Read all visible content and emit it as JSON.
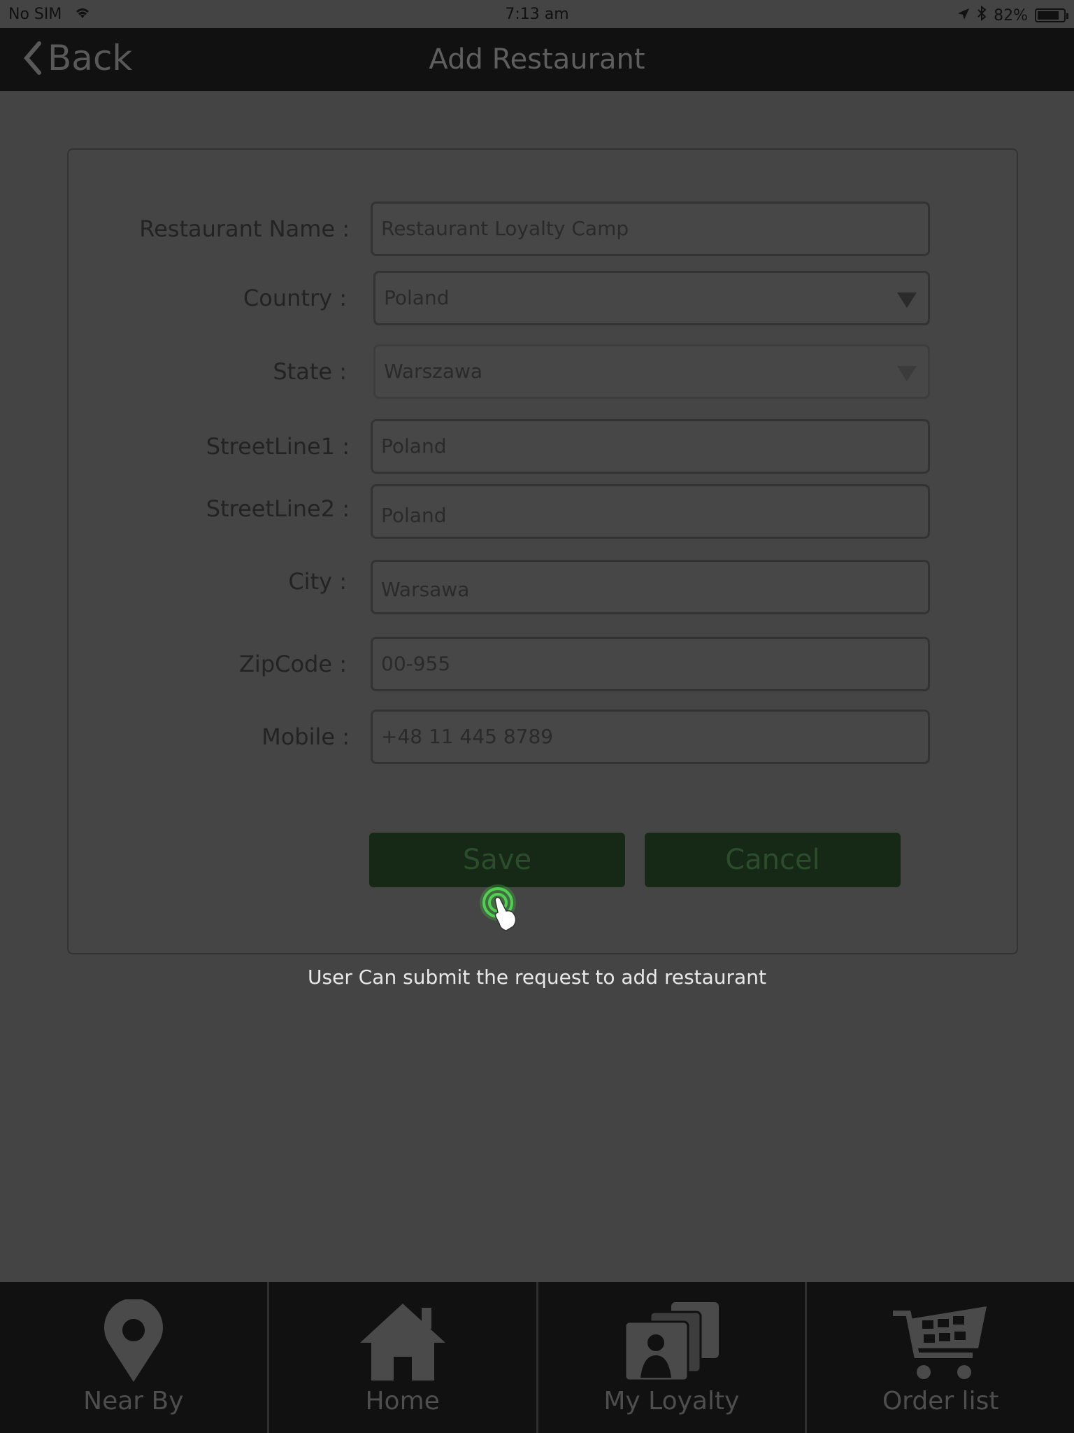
{
  "status_bar": {
    "carrier": "No SIM",
    "time": "7:13 am",
    "battery_level": 0.82,
    "battery_text": "82%"
  },
  "nav": {
    "back_label": "Back",
    "title": "Add Restaurant"
  },
  "form": {
    "restaurant_name": {
      "label": "Restaurant Name  :",
      "value": "Restaurant Loyalty Camp"
    },
    "country": {
      "label": "Country :",
      "value": "Poland"
    },
    "state": {
      "label": "State :",
      "value": "Warszawa"
    },
    "street1": {
      "label": "StreetLine1 :",
      "value": "Poland"
    },
    "street2": {
      "label": "StreetLine2 :",
      "value": "Poland"
    },
    "city": {
      "label": "City :",
      "value": "Warsawa"
    },
    "zipcode": {
      "label": "ZipCode :",
      "value": "00-955"
    },
    "mobile": {
      "label": "Mobile :",
      "value": "+48 11 445 8789"
    },
    "save_label": "Save",
    "cancel_label": "Cancel"
  },
  "caption": "User Can submit the request to add restaurant",
  "tabs": [
    {
      "label": "Near By",
      "icon": "map-pin-icon"
    },
    {
      "label": "Home",
      "icon": "home-icon"
    },
    {
      "label": "My Loyalty",
      "icon": "loyalty-cards-icon"
    },
    {
      "label": "Order list",
      "icon": "cart-icon"
    }
  ],
  "colors": {
    "save_button": "#162916",
    "accent_touch": "#3fae3f"
  }
}
